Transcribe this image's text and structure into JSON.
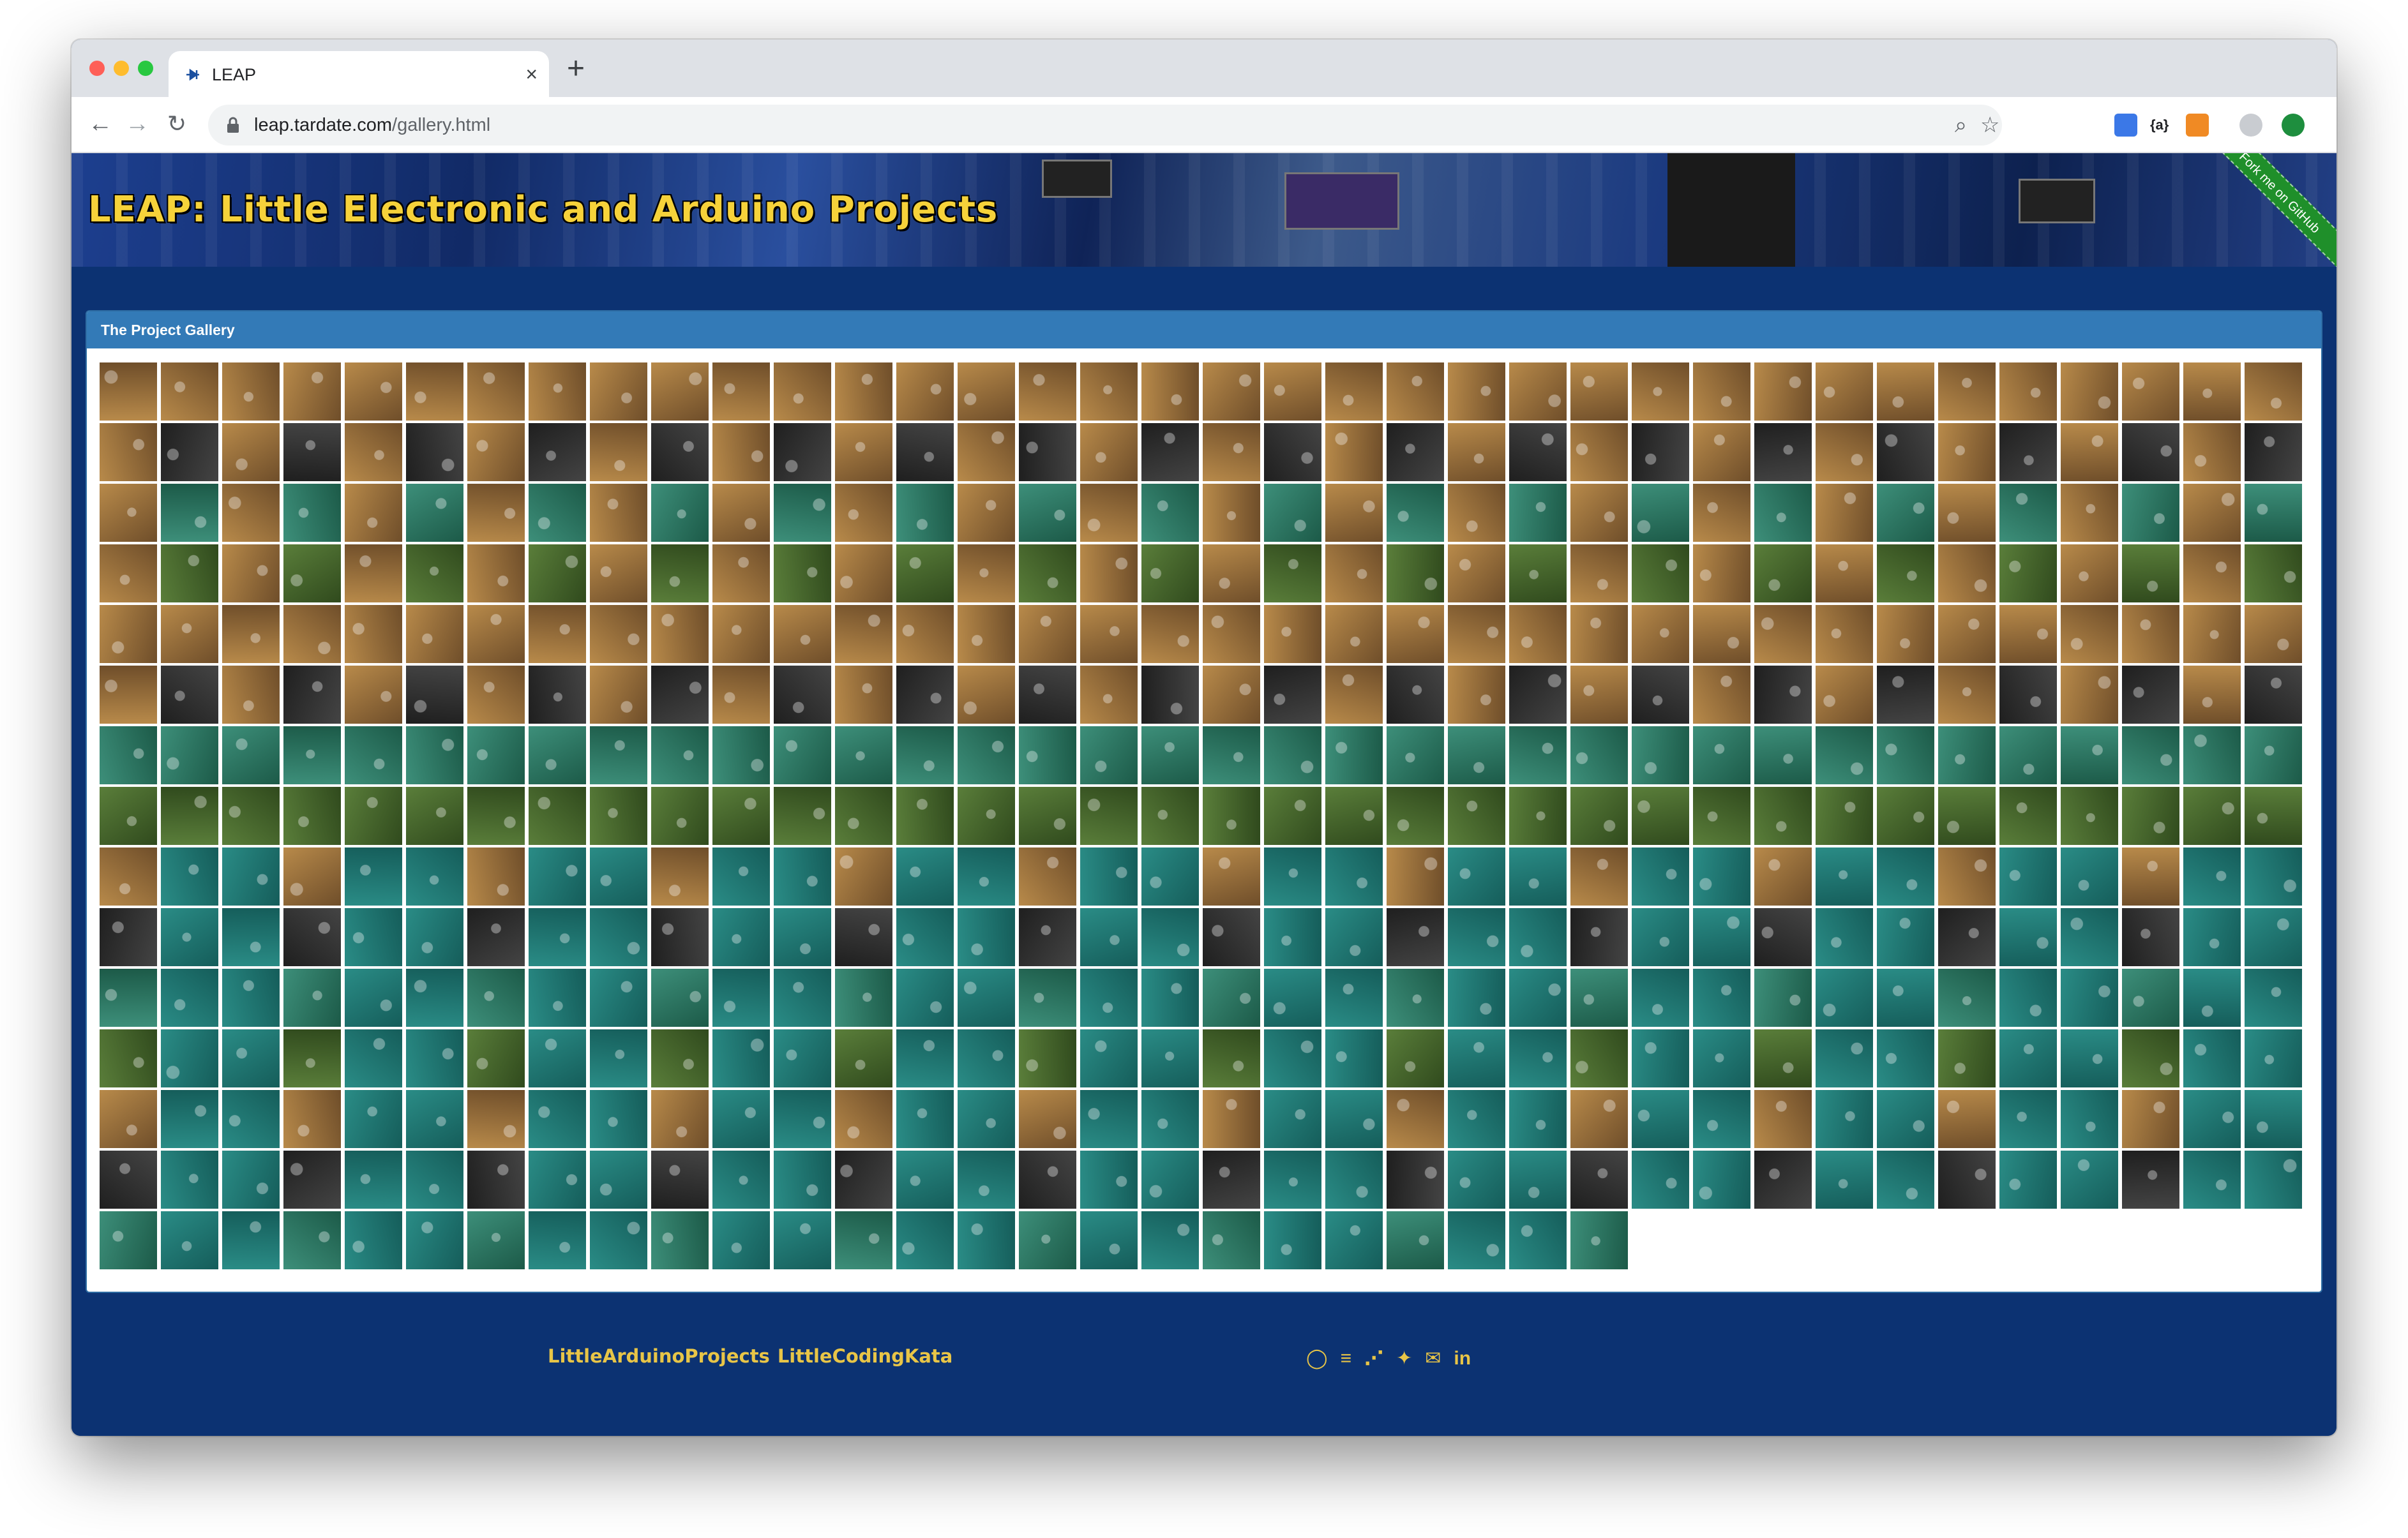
{
  "browser": {
    "tab_title": "LEAP",
    "tab_close": "×",
    "new_tab": "+",
    "url_host": "leap.tardate.com",
    "url_path": "/gallery.html",
    "icons": [
      "back-arrow-icon",
      "forward-arrow-icon",
      "reload-icon",
      "lock-icon",
      "zoom-icon",
      "star-icon"
    ],
    "extension_label": "{a}"
  },
  "banner": {
    "title": "LEAP: Little Electronic and Arduino Projects",
    "ribbon": "Fork me on GitHub"
  },
  "gallery": {
    "heading": "The Project Gallery",
    "columns": 36,
    "rows": 15,
    "last_row_count": 25,
    "thumbnail_count": 529
  },
  "footer": {
    "links": [
      "LittleArduinoProjects",
      "LittleCodingKata"
    ],
    "social": [
      {
        "name": "github-icon",
        "glyph": "◯"
      },
      {
        "name": "stackoverflow-icon",
        "glyph": "≡"
      },
      {
        "name": "rss-icon",
        "glyph": "⋰"
      },
      {
        "name": "twitter-icon",
        "glyph": "✦"
      },
      {
        "name": "email-icon",
        "glyph": "✉"
      },
      {
        "name": "linkedin-icon",
        "glyph": "in"
      }
    ]
  },
  "colors": {
    "page_bg": "#0c3272",
    "panel_heading": "#337ab7",
    "accent": "#e8c547",
    "title": "#f6d23a",
    "ribbon": "#1f8f2a"
  }
}
